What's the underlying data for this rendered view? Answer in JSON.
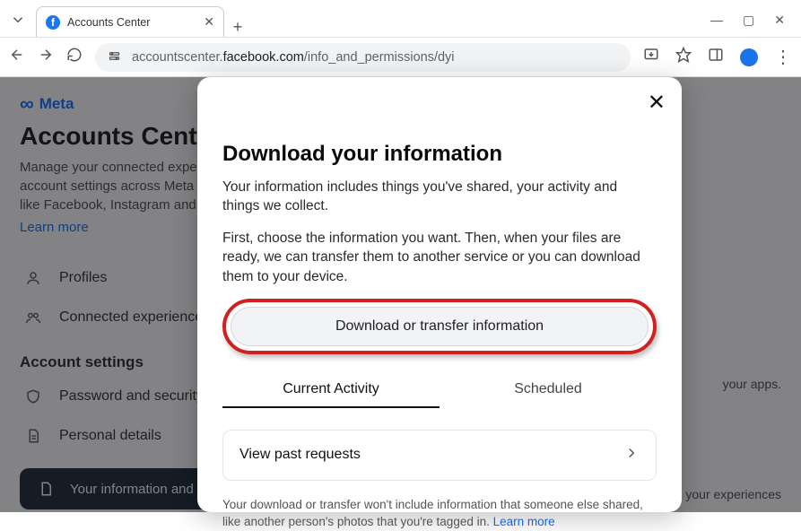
{
  "browser": {
    "tab_title": "Accounts Center",
    "url_prefix": "accountscenter.",
    "url_domain": "facebook.com",
    "url_path": "/info_and_permissions/dyi"
  },
  "bg": {
    "brand": "Meta",
    "h1": "Accounts Center",
    "lead": "Manage your connected experiences and account settings across Meta technologies like Facebook, Instagram and more.",
    "learn": "Learn more",
    "nav_profiles": "Profiles",
    "nav_connected": "Connected experiences",
    "section": "Account settings",
    "nav_password": "Password and security",
    "nav_personal": "Personal details",
    "active_item": "Your information and permissions",
    "right1": "your apps.",
    "right2": "nce your experiences"
  },
  "modal": {
    "title": "Download your information",
    "p1": "Your information includes things you've shared, your activity and things we collect.",
    "p2": "First, choose the information you want. Then, when your files are ready, we can transfer them to another service or you can download them to your device.",
    "cta": "Download or transfer information",
    "tab_current": "Current Activity",
    "tab_scheduled": "Scheduled",
    "card": "View past requests",
    "foot_text": "Your download or transfer won't include information that someone else shared, like another person's photos that you're tagged in. ",
    "foot_link": "Learn more"
  }
}
